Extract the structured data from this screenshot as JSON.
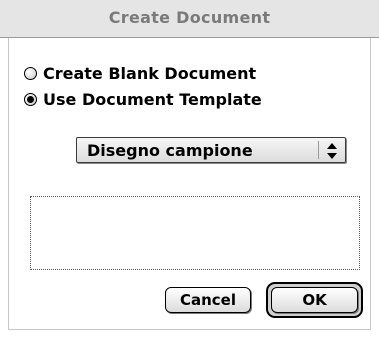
{
  "dialog": {
    "title": "Create Document"
  },
  "options": [
    {
      "label": "Create Blank Document",
      "selected": false
    },
    {
      "label": "Use Document Template",
      "selected": true
    }
  ],
  "template_popup": {
    "selected_value": "Disegno campione"
  },
  "buttons": {
    "cancel_label": "Cancel",
    "ok_label": "OK"
  }
}
